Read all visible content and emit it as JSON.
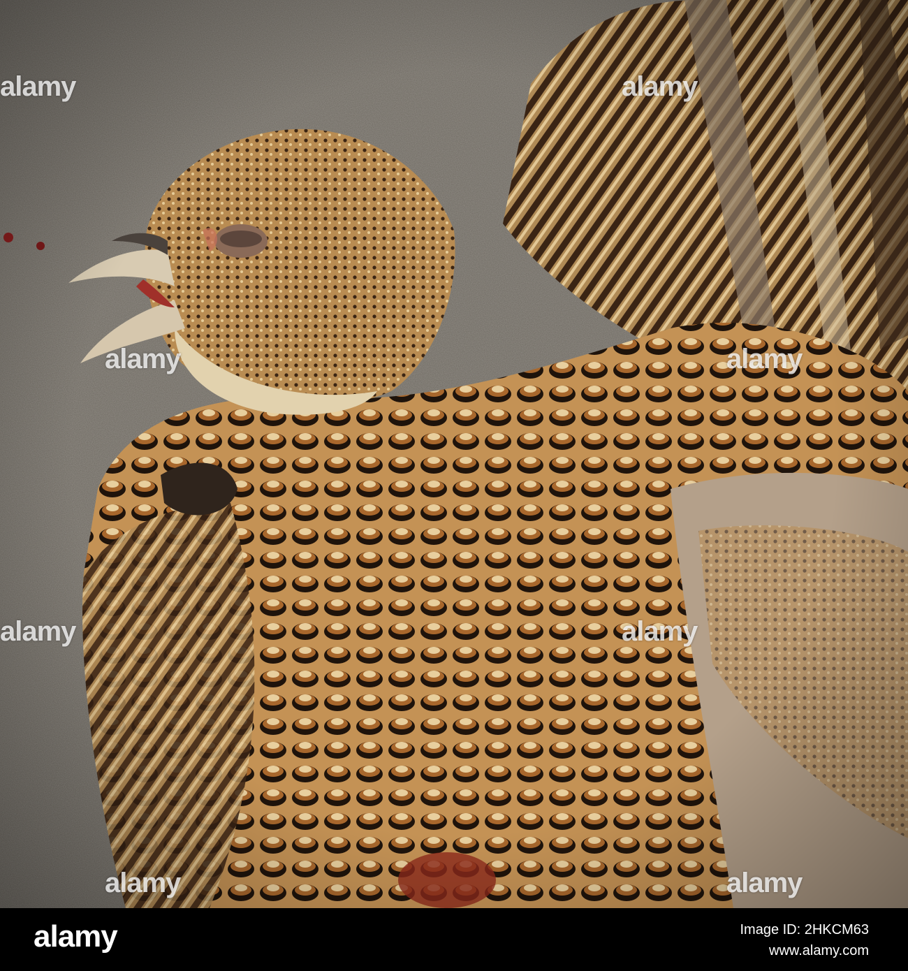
{
  "watermark": {
    "text": "alamy"
  },
  "footer": {
    "logo": "alamy",
    "image_id_label": "Image ID: 2HKCM63",
    "site": "www.alamy.com"
  },
  "colors": {
    "asphalt": "#6f6a62",
    "feather_light": "#c9a774",
    "feather_mid": "#9a6b3a",
    "feather_dark": "#2a1a10",
    "footer_bg": "#000000"
  }
}
